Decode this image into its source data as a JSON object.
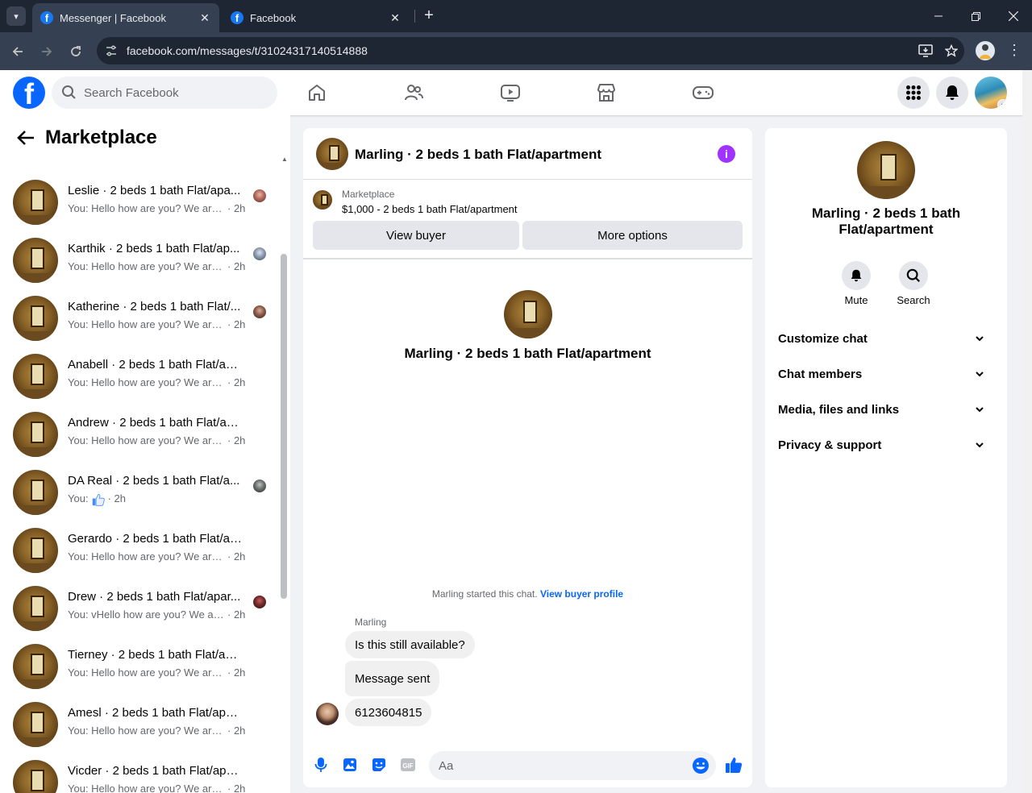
{
  "browser": {
    "tabs": [
      {
        "title": "Messenger | Facebook",
        "active": true
      },
      {
        "title": "Facebook",
        "active": false
      }
    ],
    "url": "facebook.com/messages/t/31024317140514888"
  },
  "header": {
    "search_placeholder": "Search Facebook",
    "nav_icons": [
      "home-icon",
      "friends-icon",
      "video-icon",
      "marketplace-icon",
      "gaming-icon"
    ]
  },
  "sidebar": {
    "title": "Marketplace",
    "conversations": [
      {
        "name": "Leslie · 2 beds 1 bath Flat/apa...",
        "preview": "You: Hello how are you? We are ...",
        "time": "· 2h"
      },
      {
        "name": "Karthik · 2 beds 1 bath Flat/ap...",
        "preview": "You: Hello how are you? We are ...",
        "time": "· 2h"
      },
      {
        "name": "Katherine · 2 beds 1 bath Flat/...",
        "preview": "You: Hello how are you? We are ...",
        "time": "· 2h"
      },
      {
        "name": "Anabell · 2 beds 1 bath Flat/apar...",
        "preview": "You: Hello how are you? We are rea...",
        "time": "· 2h"
      },
      {
        "name": "Andrew · 2 beds 1 bath Flat/apar...",
        "preview": "You: Hello how are you? We are rea...",
        "time": "· 2h"
      },
      {
        "name": "DA Real · 2 beds 1 bath Flat/a...",
        "preview": "You:",
        "time": "· 2h"
      },
      {
        "name": "Gerardo · 2 beds 1 bath Flat/apa...",
        "preview": "You: Hello how are you? We are rea...",
        "time": "· 2h"
      },
      {
        "name": "Drew · 2 beds 1 bath Flat/apar...",
        "preview": "You: vHello how are you? We are...",
        "time": "· 2h"
      },
      {
        "name": "Tierney · 2 beds 1 bath Flat/apar...",
        "preview": "You: Hello how are you? We are rea...",
        "time": "· 2h"
      },
      {
        "name": "Amesl · 2 beds 1 bath Flat/apart...",
        "preview": "You: Hello how are you? We are rea...",
        "time": "· 2h"
      },
      {
        "name": "Vicder · 2 beds 1 bath Flat/apart...",
        "preview": "You: Hello how are you? We are rea...",
        "time": "· 2h"
      }
    ]
  },
  "chat": {
    "title": "Marling · 2 beds 1 bath Flat/apartment",
    "listing_label": "Marketplace",
    "listing_price": "$1,000 - 2 beds 1 bath Flat/apartment",
    "view_buyer": "View buyer",
    "more_options": "More options",
    "intro_name": "Marling · 2 beds 1 bath Flat/apartment",
    "started_text": "Marling started this chat.",
    "started_link": "View buyer profile",
    "sender": "Marling",
    "messages": [
      "Is this still available?",
      "Message sent",
      "6123604815"
    ],
    "composer_placeholder": "Aa"
  },
  "info": {
    "name": "Marling · 2 beds 1 bath Flat/apartment",
    "mute": "Mute",
    "search": "Search",
    "sections": [
      "Customize chat",
      "Chat members",
      "Media, files and links",
      "Privacy & support"
    ]
  },
  "colors": {
    "brand": "#0866ff",
    "info_accent": "#a033ff",
    "bubble": "#f0f0f0"
  }
}
